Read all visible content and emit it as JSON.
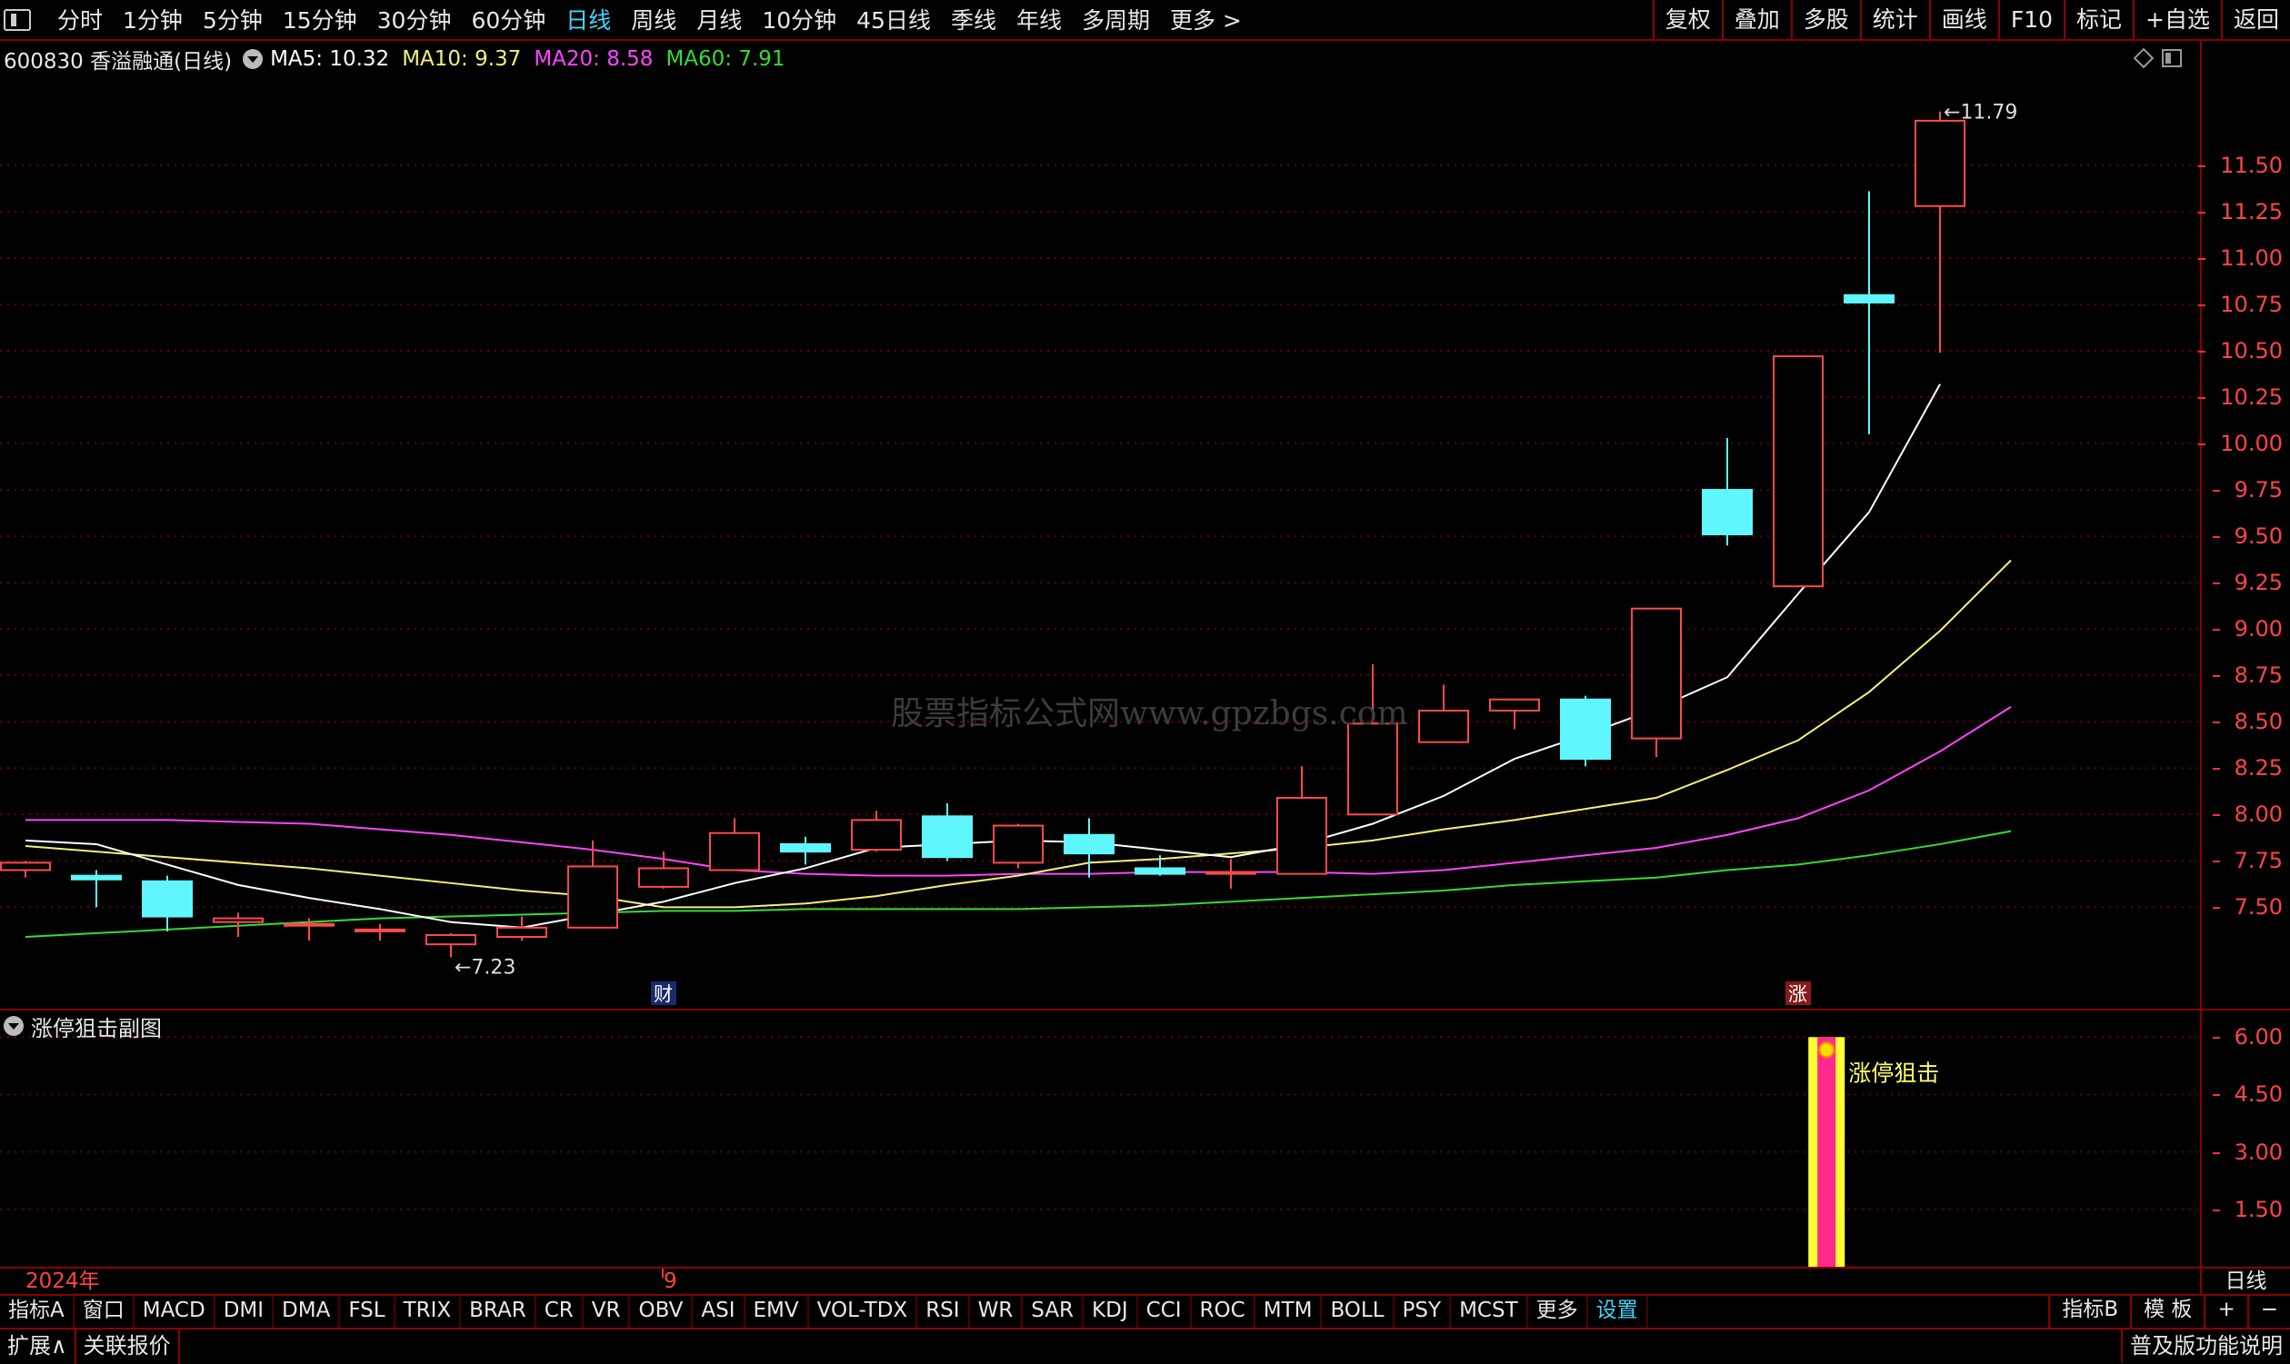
{
  "toolbar": {
    "periods": [
      "分时",
      "1分钟",
      "5分钟",
      "15分钟",
      "30分钟",
      "60分钟",
      "日线",
      "周线",
      "月线",
      "10分钟",
      "45日线",
      "季线",
      "年线",
      "多周期",
      "更多 >"
    ],
    "active_period": "日线",
    "right_buttons": [
      "复权",
      "叠加",
      "多股",
      "统计",
      "画线",
      "F10",
      "标记",
      "+自选",
      "返回"
    ]
  },
  "stock": {
    "code_name": "600830 香溢融通(日线)",
    "ma5": "MA5: 10.32",
    "ma10": "MA10: 9.37",
    "ma20": "MA20: 8.58",
    "ma60": "MA60: 7.91"
  },
  "colors": {
    "up": "#ff4a4a",
    "down": "#5ff6ff",
    "ma5": "#ffffff",
    "ma10": "#f3f07a",
    "ma20": "#ff44ff",
    "ma60": "#33dd33",
    "grid": "#8a0000",
    "axis_text": "#ff4545",
    "bar_outer": "#ffff33",
    "bar_inner": "#ff2b8a"
  },
  "watermark": "股票指标公式网www.gpzbgs.com",
  "chart_data": [
    {
      "type": "candlestick",
      "ylim": [
        7.1,
        11.95
      ],
      "y_ticks": [
        "11.50",
        "11.25",
        "11.00",
        "10.75",
        "10.50",
        "10.25",
        "10.00",
        "9.75",
        "9.50",
        "9.25",
        "9.00",
        "8.75",
        "8.50",
        "8.25",
        "8.00",
        "7.75",
        "7.50"
      ],
      "candles": [
        {
          "o": 7.7,
          "h": 7.75,
          "l": 7.66,
          "c": 7.74
        },
        {
          "o": 7.67,
          "h": 7.7,
          "l": 7.5,
          "c": 7.65
        },
        {
          "o": 7.64,
          "h": 7.67,
          "l": 7.37,
          "c": 7.45
        },
        {
          "o": 7.42,
          "h": 7.47,
          "l": 7.34,
          "c": 7.44
        },
        {
          "o": 7.41,
          "h": 7.44,
          "l": 7.32,
          "c": 7.41
        },
        {
          "o": 7.38,
          "h": 7.41,
          "l": 7.32,
          "c": 7.38
        },
        {
          "o": 7.3,
          "h": 7.36,
          "l": 7.23,
          "c": 7.35
        },
        {
          "o": 7.34,
          "h": 7.45,
          "l": 7.32,
          "c": 7.39
        },
        {
          "o": 7.39,
          "h": 7.86,
          "l": 7.39,
          "c": 7.72
        },
        {
          "o": 7.61,
          "h": 7.8,
          "l": 7.6,
          "c": 7.71
        },
        {
          "o": 7.7,
          "h": 7.98,
          "l": 7.7,
          "c": 7.9
        },
        {
          "o": 7.84,
          "h": 7.88,
          "l": 7.73,
          "c": 7.8
        },
        {
          "o": 7.81,
          "h": 8.02,
          "l": 7.8,
          "c": 7.97
        },
        {
          "o": 7.99,
          "h": 8.06,
          "l": 7.75,
          "c": 7.77
        },
        {
          "o": 7.74,
          "h": 7.95,
          "l": 7.71,
          "c": 7.94
        },
        {
          "o": 7.89,
          "h": 7.98,
          "l": 7.66,
          "c": 7.79
        },
        {
          "o": 7.71,
          "h": 7.78,
          "l": 7.67,
          "c": 7.68
        },
        {
          "o": 7.68,
          "h": 7.76,
          "l": 7.6,
          "c": 7.69
        },
        {
          "o": 7.68,
          "h": 8.26,
          "l": 7.68,
          "c": 8.09
        },
        {
          "o": 8.0,
          "h": 8.81,
          "l": 8.0,
          "c": 8.49
        },
        {
          "o": 8.39,
          "h": 8.7,
          "l": 8.39,
          "c": 8.56
        },
        {
          "o": 8.56,
          "h": 8.62,
          "l": 8.46,
          "c": 8.62
        },
        {
          "o": 8.62,
          "h": 8.64,
          "l": 8.26,
          "c": 8.3
        },
        {
          "o": 8.41,
          "h": 9.11,
          "l": 8.31,
          "c": 9.11
        },
        {
          "o": 9.75,
          "h": 10.03,
          "l": 9.45,
          "c": 9.51
        },
        {
          "o": 9.23,
          "h": 10.47,
          "l": 9.23,
          "c": 10.47
        },
        {
          "o": 10.8,
          "h": 11.36,
          "l": 10.05,
          "c": 10.76
        },
        {
          "o": 11.28,
          "h": 11.79,
          "l": 10.49,
          "c": 11.74
        }
      ],
      "ma5": [
        7.86,
        7.84,
        7.73,
        7.62,
        7.55,
        7.49,
        7.42,
        7.39,
        7.46,
        7.53,
        7.63,
        7.71,
        7.82,
        7.84,
        7.86,
        7.85,
        7.81,
        7.77,
        7.84,
        7.95,
        8.1,
        8.3,
        8.43,
        8.57,
        8.74,
        9.19,
        9.63,
        10.32
      ],
      "ma10": [
        7.83,
        7.8,
        7.77,
        7.74,
        7.71,
        7.67,
        7.63,
        7.59,
        7.56,
        7.5,
        7.5,
        7.52,
        7.56,
        7.62,
        7.67,
        7.74,
        7.76,
        7.79,
        7.82,
        7.86,
        7.92,
        7.97,
        8.03,
        8.09,
        8.24,
        8.4,
        8.66,
        8.99,
        9.37
      ],
      "ma20": [
        7.97,
        7.97,
        7.97,
        7.96,
        7.95,
        7.92,
        7.89,
        7.85,
        7.81,
        7.76,
        7.7,
        7.68,
        7.67,
        7.67,
        7.68,
        7.68,
        7.69,
        7.69,
        7.69,
        7.68,
        7.7,
        7.74,
        7.78,
        7.82,
        7.89,
        7.98,
        8.13,
        8.34,
        8.58
      ],
      "ma60": [
        7.34,
        7.36,
        7.38,
        7.4,
        7.42,
        7.44,
        7.45,
        7.46,
        7.47,
        7.48,
        7.48,
        7.49,
        7.49,
        7.49,
        7.49,
        7.5,
        7.51,
        7.53,
        7.55,
        7.57,
        7.59,
        7.62,
        7.64,
        7.66,
        7.7,
        7.73,
        7.78,
        7.84,
        7.91
      ],
      "high_label": "11.79",
      "low_label": "7.23",
      "markers": [
        {
          "index": 9,
          "text": "财"
        },
        {
          "index": 25,
          "text": "涨"
        }
      ]
    },
    {
      "type": "bar",
      "title": "涨停狙击副图",
      "ylim": [
        0,
        6.6
      ],
      "y_ticks": [
        "6.00",
        "4.50",
        "3.00",
        "1.50"
      ],
      "values": [
        0,
        0,
        0,
        0,
        0,
        0,
        0,
        0,
        0,
        0,
        0,
        0,
        0,
        0,
        0,
        0,
        0,
        0,
        0,
        0,
        0,
        0,
        0,
        0,
        0,
        0,
        6,
        0,
        0
      ],
      "label": "涨停狙击",
      "label_index": 23
    }
  ],
  "dates": {
    "start": "2024年",
    "mark": "9",
    "right": "日线"
  },
  "indicator_tabs": [
    "指标A",
    "窗口",
    "MACD",
    "DMI",
    "DMA",
    "FSL",
    "TRIX",
    "BRAR",
    "CR",
    "VR",
    "OBV",
    "ASI",
    "EMV",
    "VOL-TDX",
    "RSI",
    "WR",
    "SAR",
    "KDJ",
    "CCI",
    "ROC",
    "MTM",
    "BOLL",
    "PSY",
    "MCST",
    "更多",
    "设置"
  ],
  "indicator_right": [
    "指标B",
    "模 板",
    "+",
    "−"
  ],
  "bottom": {
    "left": [
      "扩展∧",
      "关联报价"
    ],
    "right": "普及版功能说明"
  }
}
